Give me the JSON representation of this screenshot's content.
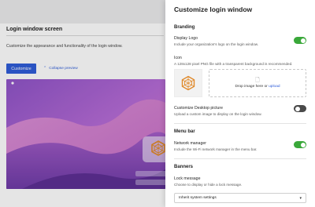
{
  "background": {
    "title": "Login window screen",
    "description": "Customize the appearance and functionality of the login window.",
    "customize_button": "Customize",
    "collapse_link": "Collapse preview"
  },
  "panel": {
    "title": "Customize login window",
    "branding": {
      "heading": "Branding",
      "display_logo_label": "Display Logo",
      "display_logo_desc": "Include your organization's logo on the login window.",
      "display_logo_on": true,
      "icon_label": "Icon",
      "icon_desc": "A 128x128 pixel PNG file with a transparent background is recommended.",
      "drop_text": "Drop image here or ",
      "drop_link": "upload",
      "desktop_label": "Customize Desktop picture",
      "desktop_desc": "Upload a custom image to display on the login window.",
      "desktop_on": false
    },
    "menu_bar": {
      "heading": "Menu bar",
      "network_label": "Network manager",
      "network_desc": "Include the Wi-Fi network manager in the menu bar.",
      "network_on": true
    },
    "banners": {
      "heading": "Banners",
      "lock_label": "Lock message",
      "lock_desc": "Choose to display or hide a lock message.",
      "lock_select": "Inherit system settings"
    }
  },
  "colors": {
    "accent": "#2f5dd8",
    "toggle_on": "#3aa83a",
    "toggle_off": "#4a4a4a",
    "logo": "#e0892a"
  },
  "icons": [
    "document-icon",
    "chevron-up-icon",
    "caret-down-icon",
    "hexagon-logo-icon"
  ]
}
